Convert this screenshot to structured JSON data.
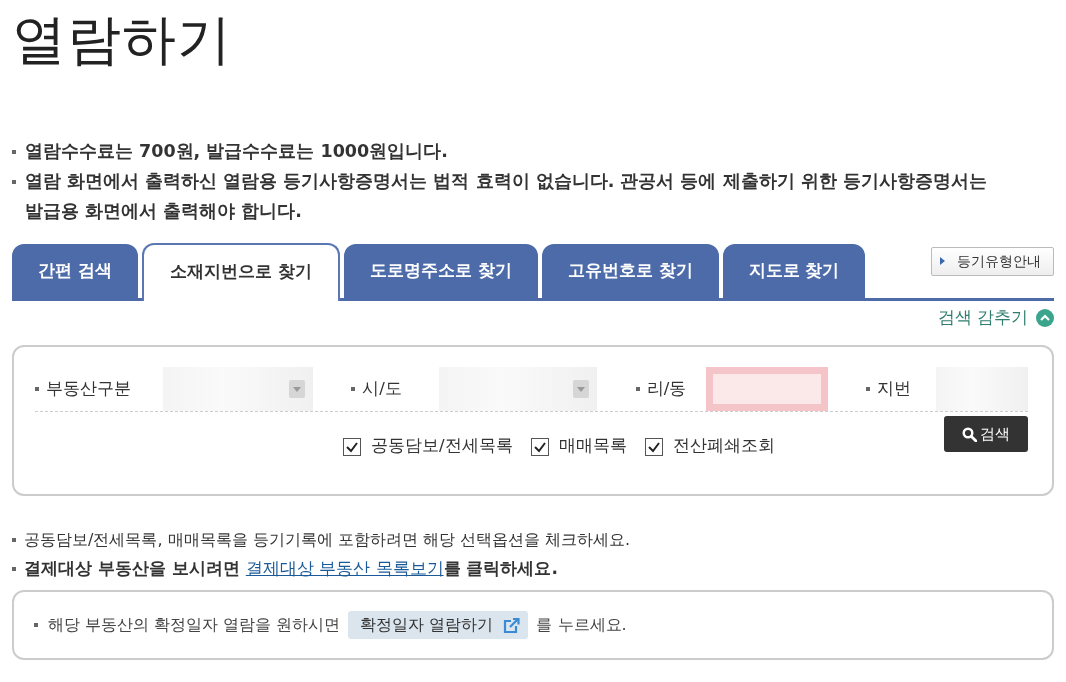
{
  "page": {
    "title": "열람하기"
  },
  "notices": [
    "열람수수료는 700원, 발급수수료는 1000원입니다.",
    "열람 화면에서 출력하신 열람용 등기사항증명서는 법적 효력이 없습니다. 관공서 등에 제출하기 위한 등기사항증명서는 발급용 화면에서 출력해야 합니다."
  ],
  "tabs": [
    {
      "label": "간편 검색",
      "selected": false
    },
    {
      "label": "소재지번으로 찾기",
      "selected": true
    },
    {
      "label": "도로명주소로 찾기",
      "selected": false
    },
    {
      "label": "고유번호로 찾기",
      "selected": false
    },
    {
      "label": "지도로 찾기",
      "selected": false
    }
  ],
  "type_guide_button": {
    "label": "등기유형안내"
  },
  "search_toggle": {
    "label": "검색 감추기",
    "expanded": true
  },
  "search_form": {
    "fields": [
      {
        "label": "부동산구분",
        "kind": "select",
        "highlighted": false
      },
      {
        "label": "시/도",
        "kind": "select",
        "highlighted": false
      },
      {
        "label": "리/동",
        "kind": "input",
        "highlighted": true
      },
      {
        "label": "지번",
        "kind": "input",
        "highlighted": false
      }
    ],
    "options": [
      {
        "label": "공동담보/전세목록",
        "checked": true
      },
      {
        "label": "매매목록",
        "checked": true
      },
      {
        "label": "전산폐쇄조회",
        "checked": true
      }
    ],
    "search_button": {
      "label": "검색"
    }
  },
  "hints": [
    {
      "bold": false,
      "before": "공동담보/전세목록, 매매목록을 등기기록에 포함하려면 해당 선택옵션을 체크하세요."
    },
    {
      "bold": true,
      "before": "결제대상 부동산을 보시려면 ",
      "link": "결제대상 부동산 목록보기",
      "after": "를 클릭하세요."
    }
  ],
  "confirm_box": {
    "before": "해당 부동산의 확정일자 열람을 원하시면",
    "button": "확정일자 열람하기",
    "after": "를 누르세요."
  }
}
